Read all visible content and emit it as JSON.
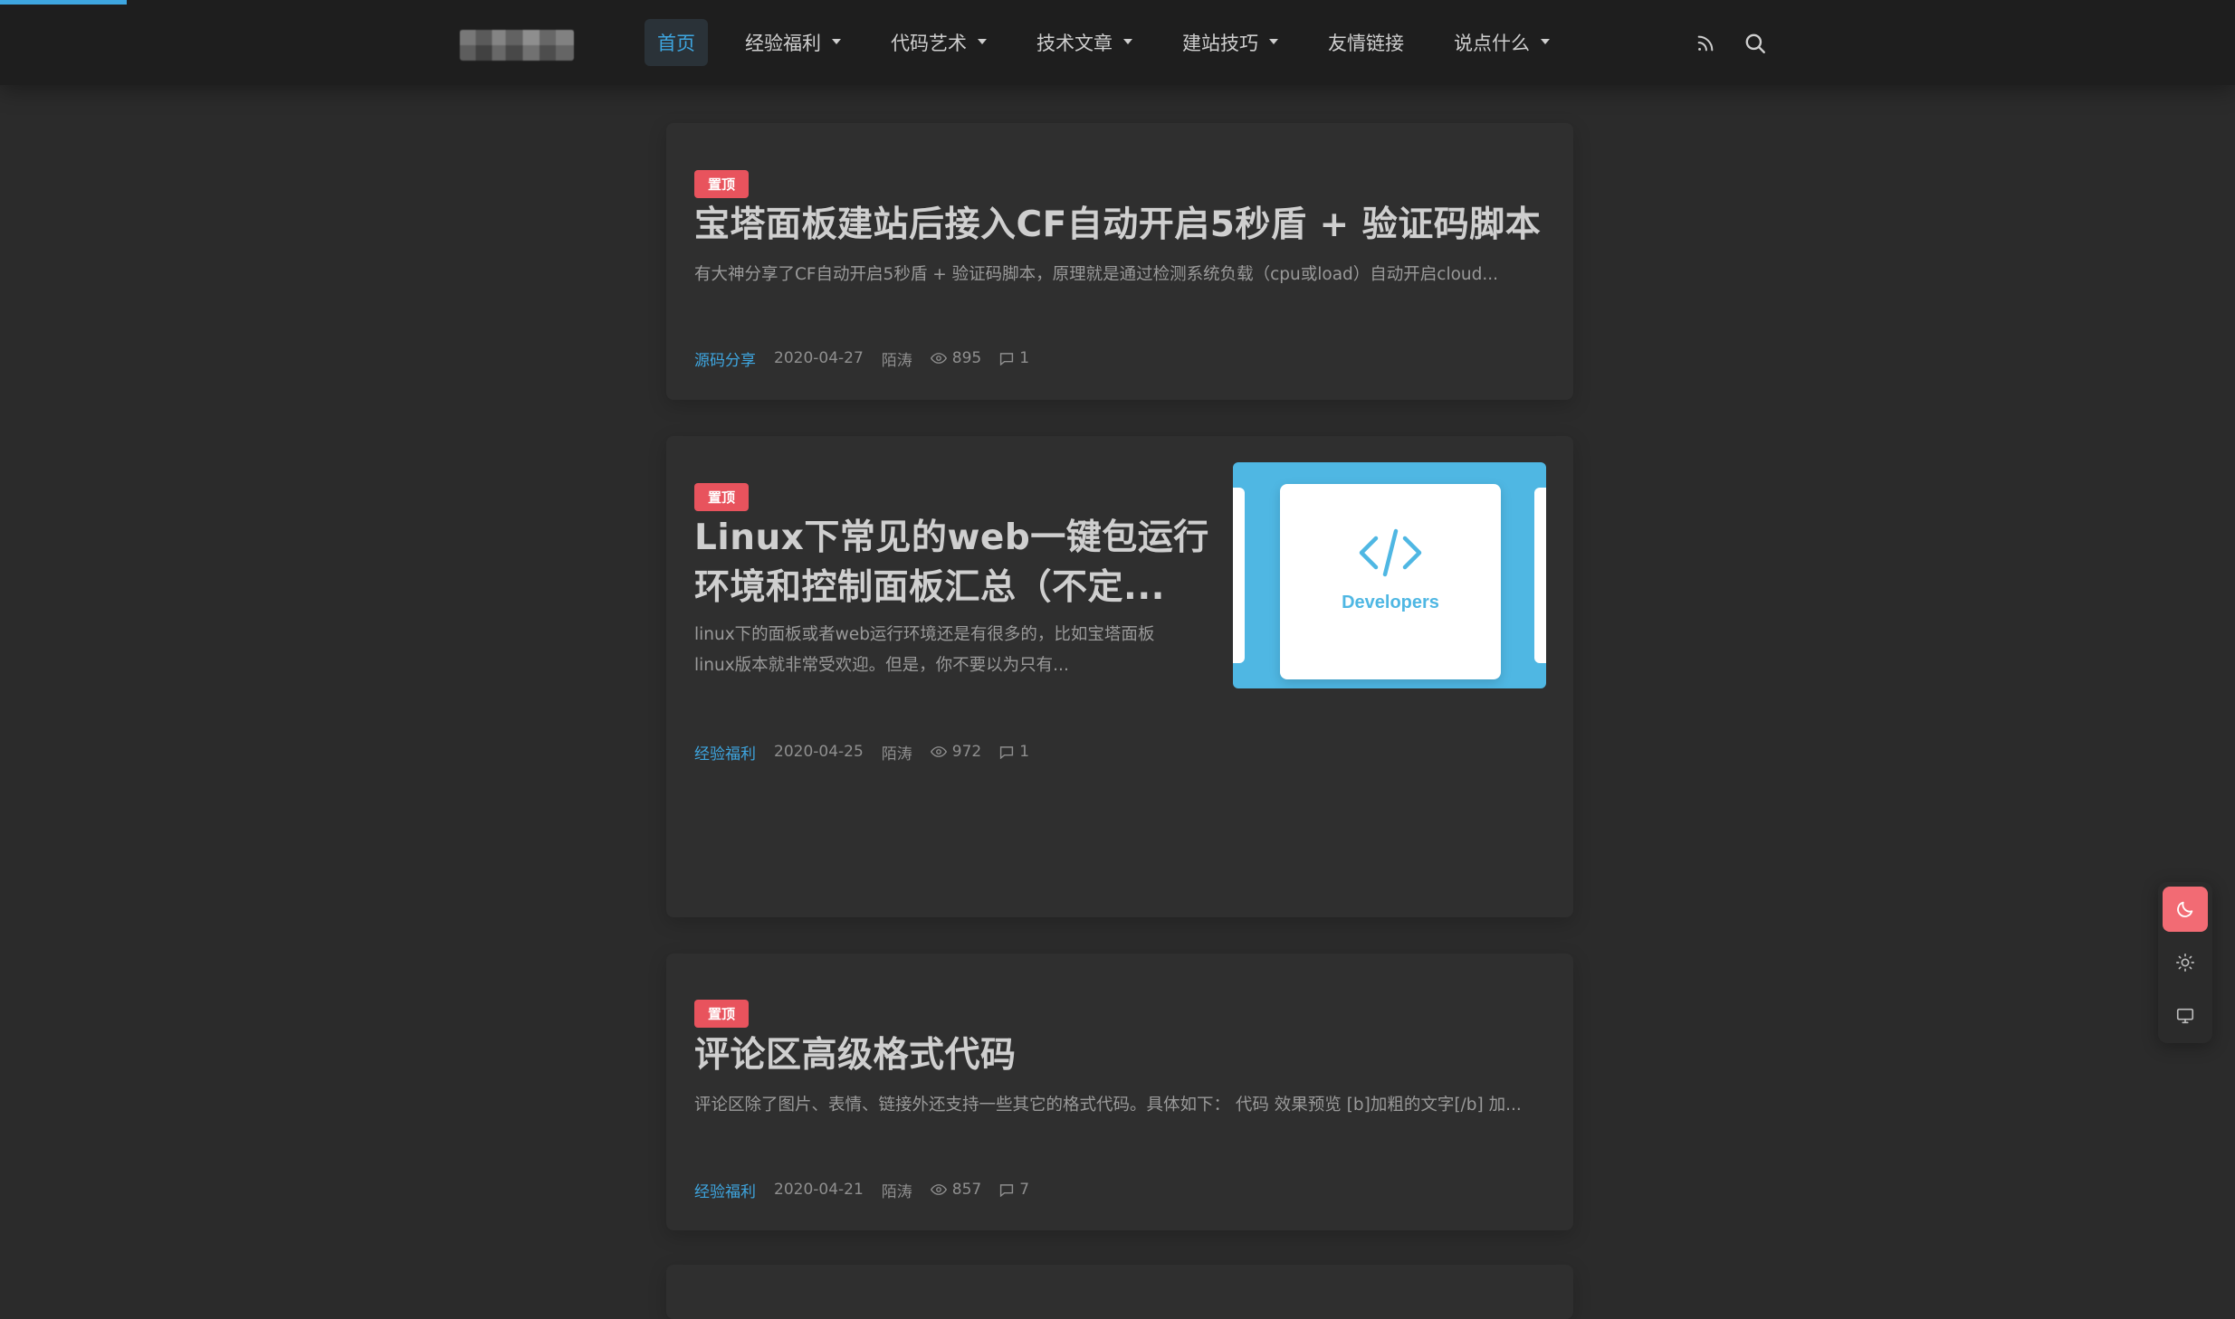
{
  "header": {
    "nav": [
      {
        "label": "首页",
        "active": true,
        "has_dropdown": false
      },
      {
        "label": "经验福利",
        "active": false,
        "has_dropdown": true
      },
      {
        "label": "代码艺术",
        "active": false,
        "has_dropdown": true
      },
      {
        "label": "技术文章",
        "active": false,
        "has_dropdown": true
      },
      {
        "label": "建站技巧",
        "active": false,
        "has_dropdown": true
      },
      {
        "label": "友情链接",
        "active": false,
        "has_dropdown": false
      },
      {
        "label": "说点什么",
        "active": false,
        "has_dropdown": true
      }
    ],
    "icons": [
      "rss-icon",
      "search-icon"
    ]
  },
  "posts": [
    {
      "badge": "置顶",
      "title": "宝塔面板建站后接入CF自动开启5秒盾 + 验证码脚本",
      "excerpt": "有大神分享了CF自动开启5秒盾 + 验证码脚本，原理就是通过检测系统负载（cpu或load）自动开启cloud...",
      "category": "源码分享",
      "date": "2020-04-27",
      "author": "陌涛",
      "views": "895",
      "comments": "1"
    },
    {
      "badge": "置顶",
      "title_line1": "Linux下常见的web一键包运行",
      "title_line2": "环境和控制面板汇总（不定...",
      "excerpt_line1": "linux下的面板或者web运行环境还是有很多的，比如宝塔面板",
      "excerpt_line2": "linux版本就非常受欢迎。但是，你不要以为只有...",
      "thumb_label": "Developers",
      "thumb_icon": "code-brackets-icon",
      "category": "经验福利",
      "date": "2020-04-25",
      "author": "陌涛",
      "views": "972",
      "comments": "1"
    },
    {
      "badge": "置顶",
      "title": "评论区高级格式代码",
      "excerpt": "评论区除了图片、表情、链接外还支持一些其它的格式代码。具体如下： 代码 效果预览 [b]加粗的文字[/b] 加...",
      "category": "经验福利",
      "date": "2020-04-21",
      "author": "陌涛",
      "views": "857",
      "comments": "7"
    }
  ],
  "theme_switcher": {
    "options": [
      "moon-icon",
      "sun-icon",
      "monitor-icon"
    ],
    "active": "moon-icon"
  },
  "colors": {
    "accent": "#3ea6e0",
    "badge": "#e8535d",
    "header_bg": "#1e1e1e",
    "page_bg": "#2b2b2b",
    "card_bg": "#2f2f2f",
    "theme_active": "#f26b74"
  }
}
